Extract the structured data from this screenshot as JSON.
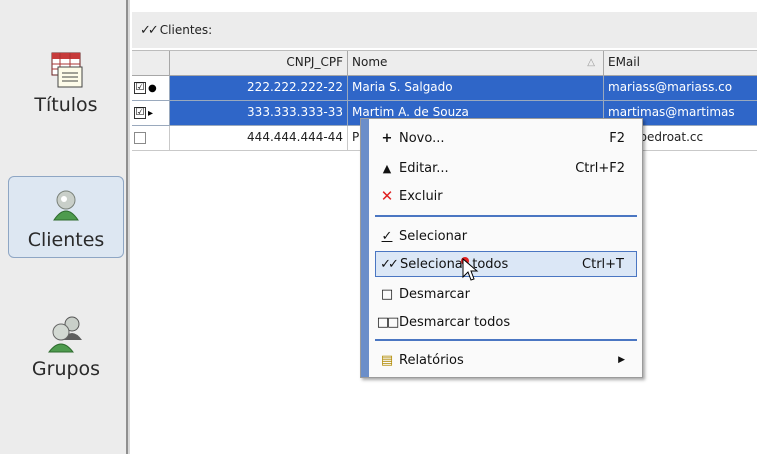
{
  "sidebar": {
    "items": [
      {
        "label": "Títulos",
        "icon": "titles-icon"
      },
      {
        "label": "Clientes",
        "icon": "clients-icon",
        "active": true
      },
      {
        "label": "Grupos",
        "icon": "groups-icon"
      }
    ]
  },
  "panel": {
    "title": "Clientes:"
  },
  "grid": {
    "columns": [
      "CNPJ_CPF",
      "Nome",
      "EMail"
    ],
    "rows": [
      {
        "cnpj": "222.222.222-22",
        "nome": "Maria S. Salgado",
        "email": "mariass@mariass.co",
        "checked": "☑",
        "state": "selected"
      },
      {
        "cnpj": "333.333.333-33",
        "nome": "Martim A. de Souza",
        "email": "martimas@martimas",
        "checked": "☑",
        "state": "selected"
      },
      {
        "cnpj": "444.444.444-44",
        "nome": "P",
        "email": "oat@pedroat.cc",
        "checked": "",
        "state": "plain"
      }
    ]
  },
  "context_menu": {
    "items": [
      {
        "icon": "+",
        "label": "Novo...",
        "shortcut": "F2"
      },
      {
        "icon": "▲",
        "label": "Editar...",
        "shortcut": "Ctrl+F2"
      },
      {
        "icon": "✕",
        "label": "Excluir",
        "shortcut": ""
      },
      {
        "icon": "✓",
        "label": "Selecionar",
        "shortcut": ""
      },
      {
        "icon": "✓✓",
        "label": "Selecionar todos",
        "shortcut": "Ctrl+T"
      },
      {
        "icon": "□",
        "label": "Desmarcar",
        "shortcut": ""
      },
      {
        "icon": "□□",
        "label": "Desmarcar todos",
        "shortcut": ""
      },
      {
        "icon": "▤",
        "label": "Relatórios",
        "shortcut": "▶"
      }
    ]
  },
  "colors": {
    "selection": "#2f66c8",
    "menu_strip": "#6b8ec9",
    "delete_red": "#e02020"
  }
}
